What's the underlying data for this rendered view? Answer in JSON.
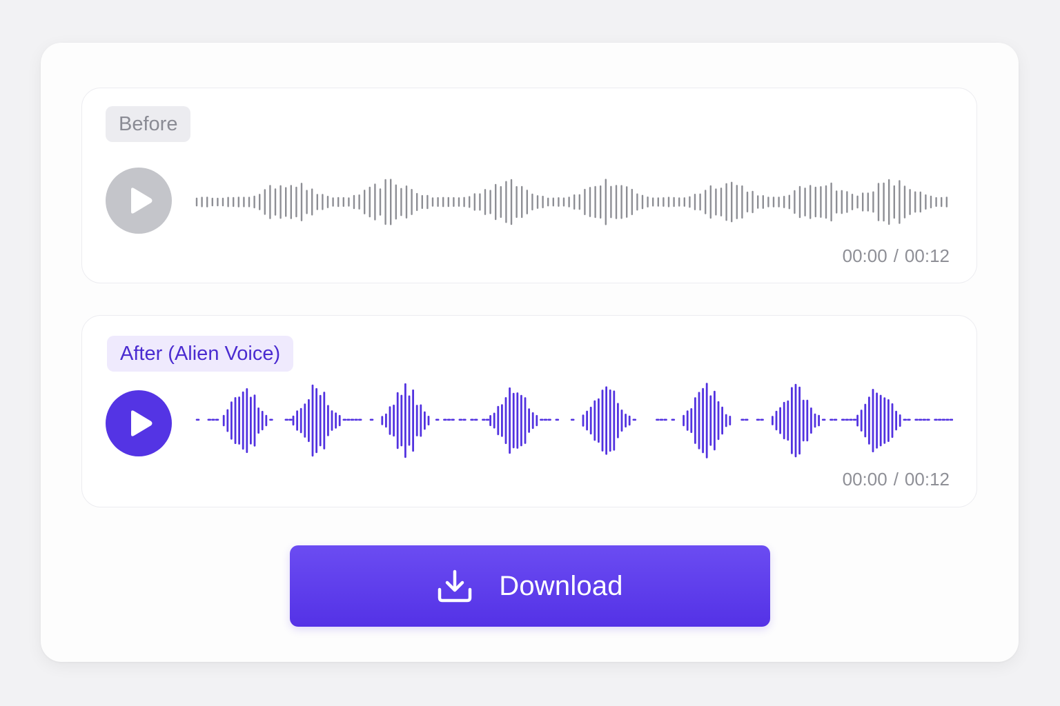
{
  "before": {
    "label": "Before",
    "current_time": "00:00",
    "separator": "/",
    "duration": "00:12",
    "play_icon": "play-icon",
    "wave_color": "#8d8e94"
  },
  "after": {
    "label": "After (Alien Voice)",
    "current_time": "00:00",
    "separator": "/",
    "duration": "00:12",
    "play_icon": "play-icon",
    "wave_color": "#5232e0"
  },
  "download": {
    "label": "Download",
    "icon": "download-icon"
  },
  "colors": {
    "accent": "#5434e4",
    "muted": "#c4c5ca",
    "badge_before_bg": "#ececf0",
    "badge_after_bg": "#efeafd"
  }
}
